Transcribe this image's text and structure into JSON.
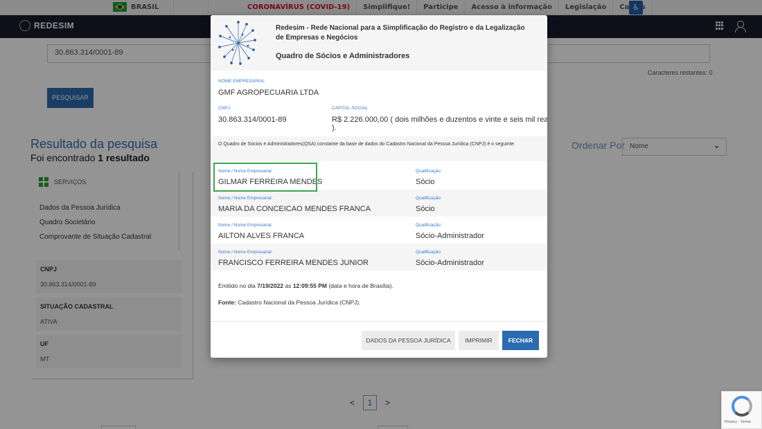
{
  "govbar": {
    "country": "BRASIL",
    "links": [
      "CORONAVÍRUS (COVID-19)",
      "Simplifique!",
      "Participe",
      "Acesso à informação",
      "Legislação",
      "Canais"
    ]
  },
  "header": {
    "logo": "REDESIM"
  },
  "search": {
    "cnpj_value": "30.863.314/0001-89",
    "chars_remaining": "Caracteres restantes: 0",
    "button": "PESQUISAR"
  },
  "results": {
    "title": "Resultado da pesquisa",
    "found_prefix": "Foi encontrado",
    "found_count": "1 resultado",
    "order_label": "Ordenar Por",
    "order_value": "Nome"
  },
  "services": {
    "heading": "SERVIÇOS",
    "items": [
      "Dados da Pessoa Jurídica",
      "Quadro Societário",
      "Comprovante de Situação Cadastral"
    ]
  },
  "info_cards": [
    {
      "label": "CNPJ",
      "value": "30.863.314/0001-89"
    },
    {
      "label": "SITUAÇÃO CADASTRAL",
      "value": "ATIVA"
    },
    {
      "label": "UF",
      "value": "MT"
    }
  ],
  "pagination": {
    "prev": "<",
    "current": "1",
    "next": ">"
  },
  "modal": {
    "title": "Redesim - Rede Nacional para a Simplificação do Registro e da Legalização de Empresas e Negócios",
    "subtitle": "Quadro de Sócios e Administradores",
    "company_label": "NOME EMPRESARIAL",
    "company_name": "GMF AGROPECUARIA LTDA",
    "cnpj_label": "CNPJ",
    "cnpj_value": "30.863.314/0001-89",
    "capital_label": "CAPITAL SOCIAL",
    "capital_line1": "R$ 2.226.000,00 ( dois milhões e duzentos e vinte e seis mil reais",
    "capital_line2": ").",
    "qsa_note": "O Quadro de Sócios e Administradores(QSA) constante da base de dados do Cadastro Nacional da Pessoa Jurídica (CNPJ) é o seguinte:",
    "partner_name_label": "Nome / Nome Empresarial:",
    "partner_role_label": "Qualificação:",
    "partners": [
      {
        "name": "GILMAR FERREIRA MENDES",
        "role": "Sócio"
      },
      {
        "name": "MARIA DA CONCEICAO MENDES FRANCA",
        "role": "Sócio"
      },
      {
        "name": "AILTON ALVES FRANCA",
        "role": "Sócio-Administrador"
      },
      {
        "name": "FRANCISCO FERREIRA MENDES JUNIOR",
        "role": "Sócio-Administrador"
      }
    ],
    "emitted_prefix": "Emitido no dia",
    "emitted_date": "7/19/2022",
    "emitted_mid": "às",
    "emitted_time": "12:09:55 PM",
    "emitted_suffix": "(data e hora de Brasília).",
    "source_label": "Fonte:",
    "source_value": "Cadastro Nacional da Pessoa Jurídica (CNPJ).",
    "buttons": {
      "company_data": "DADOS DA PESSOA JURÍDICA",
      "print": "IMPRIMIR",
      "close": "FECHAR"
    }
  },
  "recaptcha": {
    "text": "Privacy - Terms"
  },
  "colors": {
    "accent": "#2b6cb0",
    "highlight": "#3aa84a",
    "covid": "#c8102e"
  }
}
